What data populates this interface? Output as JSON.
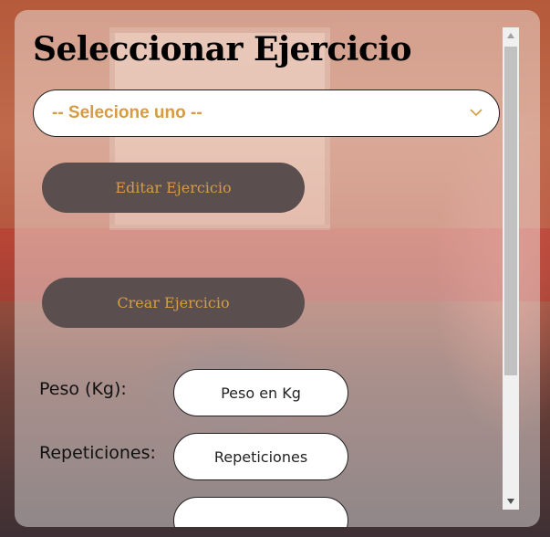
{
  "title": "Seleccionar Ejercicio",
  "select": {
    "value": "-- Selecione uno --",
    "icon": "chevron-down-icon"
  },
  "buttons": {
    "edit": "Editar Ejercicio",
    "create": "Crear Ejercicio"
  },
  "fields": [
    {
      "label": "Peso (Kg):",
      "placeholder": "Peso en Kg"
    },
    {
      "label": "Repeticiones:",
      "placeholder": "Repeticiones"
    }
  ],
  "colors": {
    "accent": "#d79b44",
    "button_bg": "#5b4e4e",
    "panel_bg": "rgba(255,255,255,0.42)"
  },
  "scroll": {
    "position": 0.0,
    "visible_fraction": 0.68
  }
}
